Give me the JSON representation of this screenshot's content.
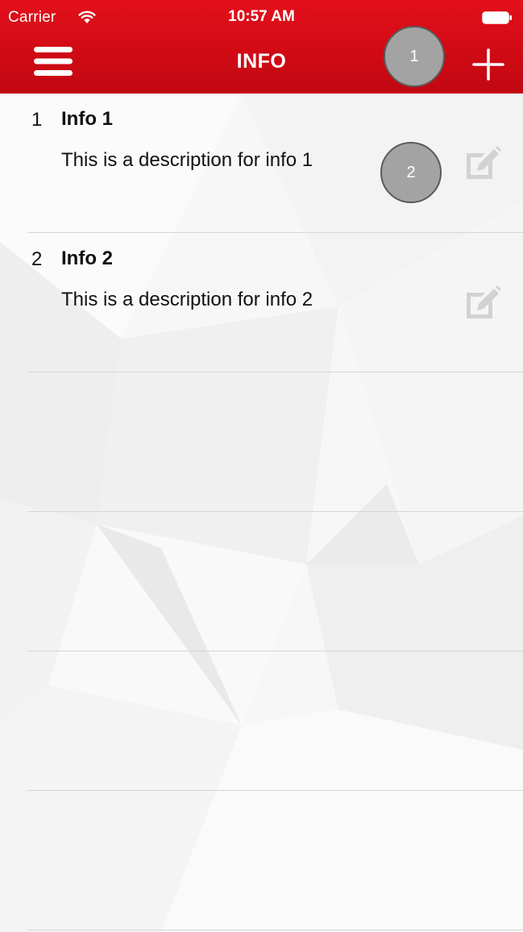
{
  "status_bar": {
    "carrier": "Carrier",
    "time": "10:57 AM"
  },
  "nav": {
    "title": "INFO",
    "menu_icon": "hamburger-menu-icon",
    "add_icon": "plus-icon"
  },
  "items": [
    {
      "index": "1",
      "title": "Info 1",
      "description": "This is a description for info 1",
      "action_icon": "edit-icon"
    },
    {
      "index": "2",
      "title": "Info 2",
      "description": "This is a description for info 2",
      "action_icon": "edit-icon"
    }
  ],
  "callouts": [
    "1",
    "2"
  ],
  "colors": {
    "header": "#d50c16",
    "text": "#111111",
    "separator": "#d6d6d6",
    "icon_muted": "#d2d2d2",
    "callout": "#a3a3a3"
  }
}
